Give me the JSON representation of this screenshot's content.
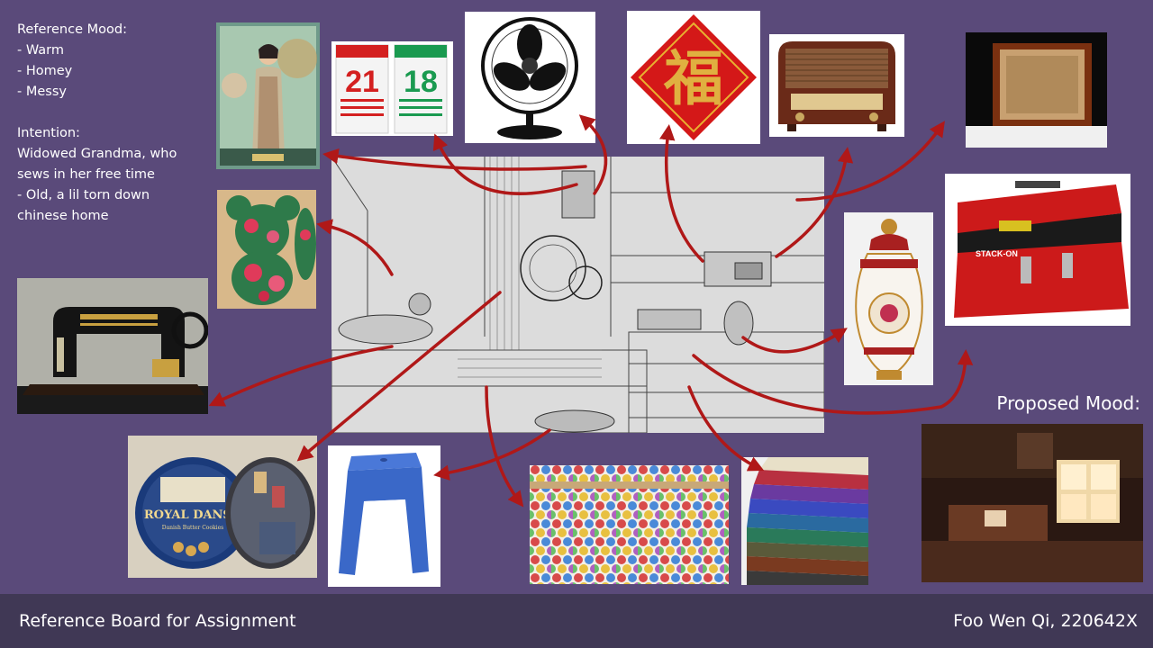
{
  "notes": {
    "reference_mood_heading": "Reference Mood:",
    "mood_items": [
      "- Warm",
      "- Homey",
      "- Messy"
    ],
    "intention_heading": "Intention:",
    "intention_lines": [
      "Widowed Grandma, who",
      "sews in her free time",
      "- Old, a lil torn down",
      "chinese home"
    ]
  },
  "images": {
    "calendar_left_day": "21",
    "calendar_right_day": "18",
    "fu_character": "福",
    "cookie_tin_brand": "ROYAL DANSK",
    "cookie_tin_sub": "Danish Butter Cookies",
    "toolbox_brand": "STACK-ON"
  },
  "proposed_mood_label": "Proposed Mood:",
  "footer": {
    "title": "Reference Board for Assignment",
    "author": "Foo Wen Qi, 220642X"
  },
  "colors": {
    "background": "#5a4a7a",
    "footer_band": "#403855",
    "arrow": "#b01818",
    "text": "#ffffff"
  }
}
